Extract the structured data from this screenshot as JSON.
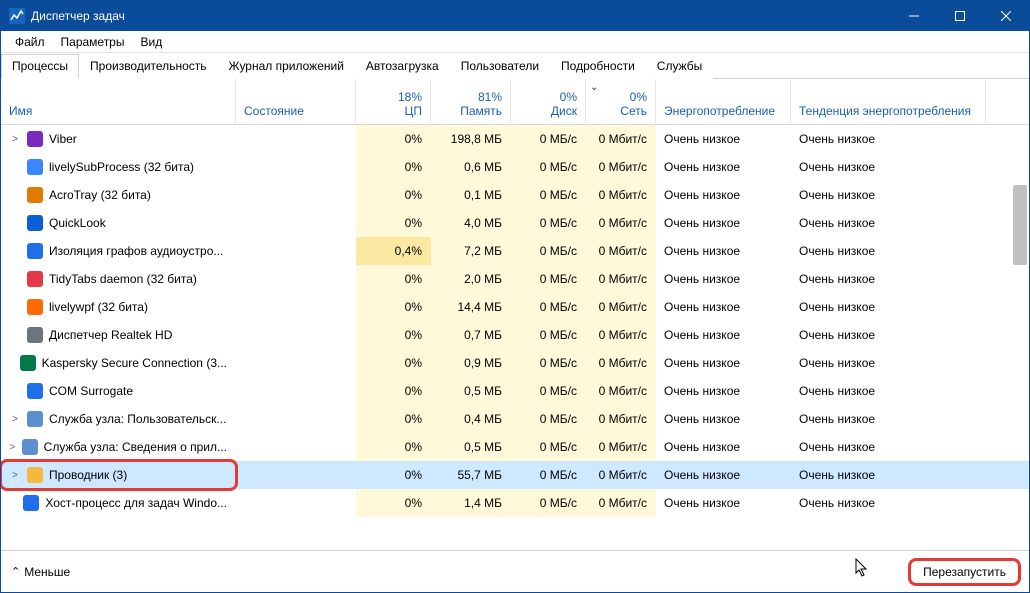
{
  "window": {
    "title": "Диспетчер задач"
  },
  "menu": {
    "file": "Файл",
    "options": "Параметры",
    "view": "Вид"
  },
  "tabs": {
    "items": [
      {
        "label": "Процессы"
      },
      {
        "label": "Производительность"
      },
      {
        "label": "Журнал приложений"
      },
      {
        "label": "Автозагрузка"
      },
      {
        "label": "Пользователи"
      },
      {
        "label": "Подробности"
      },
      {
        "label": "Службы"
      }
    ],
    "active": 0
  },
  "columns": {
    "name": "Имя",
    "state": "Состояние",
    "cpu_pct": "18%",
    "cpu_lbl": "ЦП",
    "mem_pct": "81%",
    "mem_lbl": "Память",
    "disk_pct": "0%",
    "disk_lbl": "Диск",
    "net_pct": "0%",
    "net_lbl": "Сеть",
    "energy": "Энергопотребление",
    "etrend": "Тенденция энергопотребления"
  },
  "rows": [
    {
      "exp": ">",
      "icon": "#7b2cbf",
      "name": "Viber",
      "cpu": "0%",
      "mem": "198,8 МБ",
      "disk": "0 МБ/с",
      "net": "0 Мбит/с",
      "energy": "Очень низкое",
      "etrend": "Очень низкое"
    },
    {
      "exp": "",
      "icon": "#3a86ff",
      "name": "livelySubProcess (32 бита)",
      "cpu": "0%",
      "mem": "0,6 МБ",
      "disk": "0 МБ/с",
      "net": "0 Мбит/с",
      "energy": "Очень низкое",
      "etrend": "Очень низкое"
    },
    {
      "exp": "",
      "icon": "#e07a00",
      "name": "AcroTray (32 бита)",
      "cpu": "0%",
      "mem": "0,1 МБ",
      "disk": "0 МБ/с",
      "net": "0 Мбит/с",
      "energy": "Очень низкое",
      "etrend": "Очень низкое"
    },
    {
      "exp": "",
      "icon": "#0b5ed7",
      "name": "QuickLook",
      "cpu": "0%",
      "mem": "4,0 МБ",
      "disk": "0 МБ/с",
      "net": "0 Мбит/с",
      "energy": "Очень низкое",
      "etrend": "Очень низкое"
    },
    {
      "exp": "",
      "icon": "#1f6feb",
      "name": "Изоляция графов аудиоустро...",
      "cpu": "0,4%",
      "cpu_hot": true,
      "mem": "7,2 МБ",
      "disk": "0 МБ/с",
      "net": "0 Мбит/с",
      "energy": "Очень низкое",
      "etrend": "Очень низкое"
    },
    {
      "exp": "",
      "icon": "#e63946",
      "name": "TidyTabs daemon (32 бита)",
      "cpu": "0%",
      "mem": "2,0 МБ",
      "disk": "0 МБ/с",
      "net": "0 Мбит/с",
      "energy": "Очень низкое",
      "etrend": "Очень низкое"
    },
    {
      "exp": "",
      "icon": "#ff6b00",
      "name": "livelywpf (32 бита)",
      "cpu": "0%",
      "mem": "14,4 МБ",
      "disk": "0 МБ/с",
      "net": "0 Мбит/с",
      "energy": "Очень низкое",
      "etrend": "Очень низкое"
    },
    {
      "exp": "",
      "icon": "#6c757d",
      "name": "Диспетчер Realtek HD",
      "cpu": "0%",
      "mem": "0,7 МБ",
      "disk": "0 МБ/с",
      "net": "0 Мбит/с",
      "energy": "Очень низкое",
      "etrend": "Очень низкое"
    },
    {
      "exp": "",
      "icon": "#027a48",
      "name": "Kaspersky Secure Connection (3...",
      "cpu": "0%",
      "mem": "0,9 МБ",
      "disk": "0 МБ/с",
      "net": "0 Мбит/с",
      "energy": "Очень низкое",
      "etrend": "Очень низкое"
    },
    {
      "exp": "",
      "icon": "#1f6feb",
      "name": "COM Surrogate",
      "cpu": "0%",
      "mem": "0,5 МБ",
      "disk": "0 МБ/с",
      "net": "0 Мбит/с",
      "energy": "Очень низкое",
      "etrend": "Очень низкое"
    },
    {
      "exp": ">",
      "icon": "#5c8fcf",
      "name": "Служба узла: Пользовательск...",
      "cpu": "0%",
      "mem": "0,4 МБ",
      "disk": "0 МБ/с",
      "net": "0 Мбит/с",
      "energy": "Очень низкое",
      "etrend": "Очень низкое"
    },
    {
      "exp": ">",
      "icon": "#5c8fcf",
      "name": "Служба узла: Сведения о прил...",
      "cpu": "0%",
      "mem": "0,5 МБ",
      "disk": "0 МБ/с",
      "net": "0 Мбит/с",
      "energy": "Очень низкое",
      "etrend": "Очень низкое"
    },
    {
      "exp": ">",
      "icon": "#f4b740",
      "name": "Проводник (3)",
      "cpu": "0%",
      "mem": "55,7 МБ",
      "disk": "0 МБ/с",
      "net": "0 Мбит/с",
      "energy": "Очень низкое",
      "etrend": "Очень низкое",
      "selected": true,
      "highlight": true
    },
    {
      "exp": "",
      "icon": "#1f6feb",
      "name": "Хост-процесс для задач Windo...",
      "cpu": "0%",
      "mem": "1,4 МБ",
      "disk": "0 МБ/с",
      "net": "0 Мбит/с",
      "energy": "Очень низкое",
      "etrend": "Очень низкое"
    }
  ],
  "footer": {
    "less": "Меньше",
    "action": "Перезапустить"
  }
}
